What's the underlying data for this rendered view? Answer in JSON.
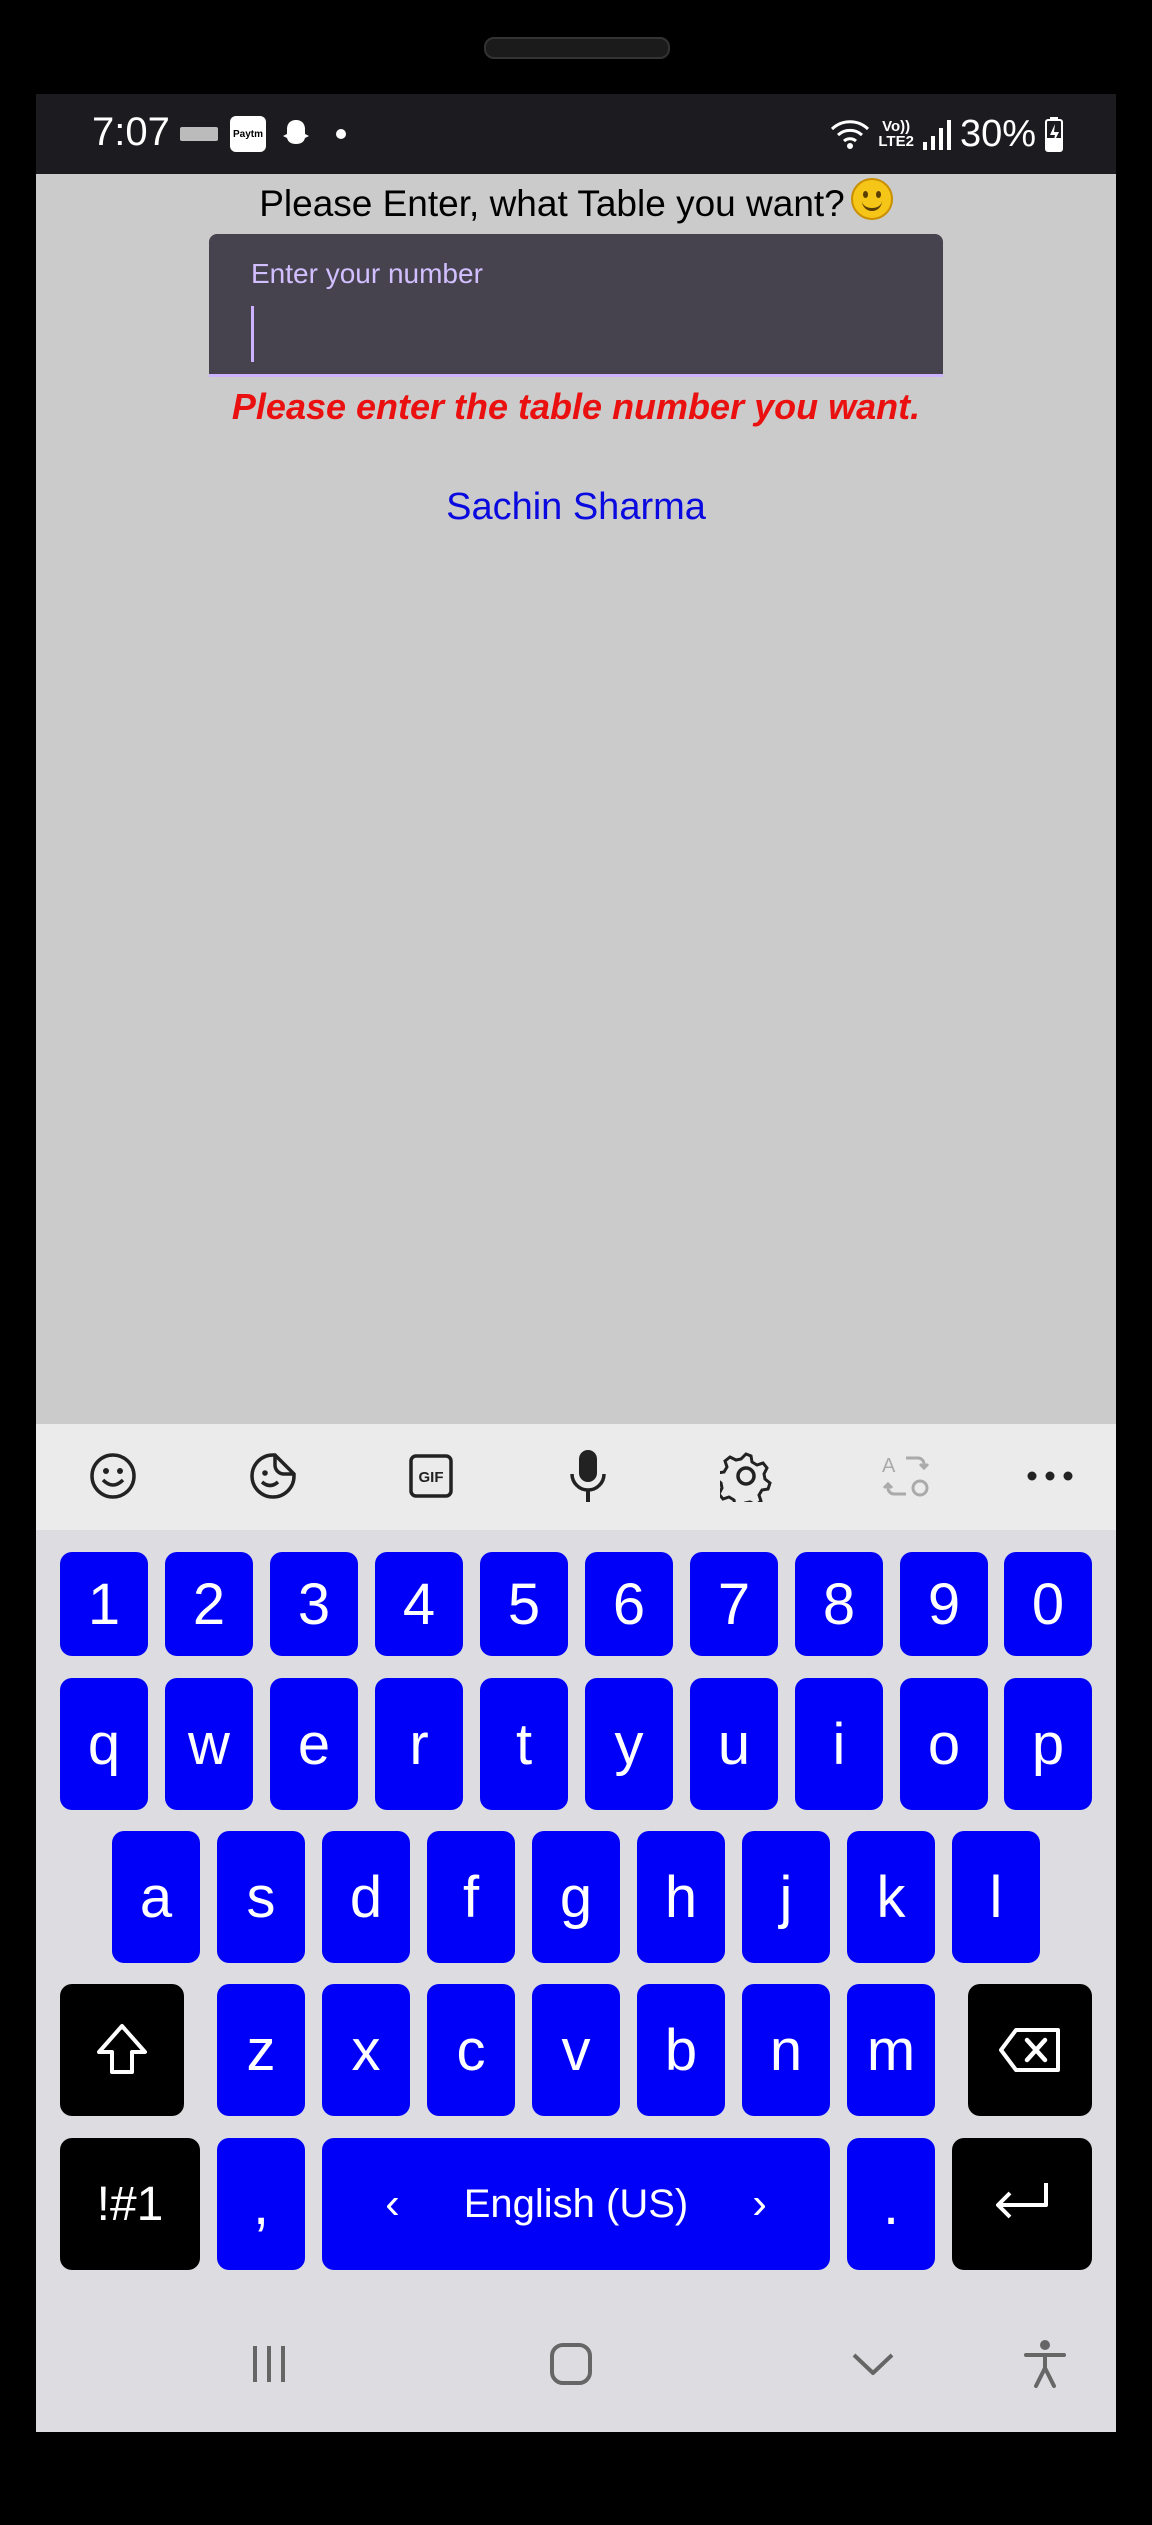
{
  "status_bar": {
    "time": "7:07",
    "notification_icons": [
      "mini-logo-icon",
      "paytm-icon",
      "snapchat-icon",
      "dot-icon"
    ],
    "paytm_text": "Paytm",
    "volte_line1": "Vo))",
    "volte_line2": "LTE2",
    "battery": "30%"
  },
  "content": {
    "title": "Please Enter, what Table you want?",
    "input_label": "Enter your number",
    "input_value": "",
    "error_message": "Please enter the table number you want.",
    "author": "Sachin Sharma"
  },
  "keyboard": {
    "toolbar_icons": [
      "emoji-icon",
      "sticker-icon",
      "gif-icon",
      "mic-icon",
      "settings-icon",
      "translate-icon",
      "more-icon"
    ],
    "gif_text": "GIF",
    "row_numbers": [
      "1",
      "2",
      "3",
      "4",
      "5",
      "6",
      "7",
      "8",
      "9",
      "0"
    ],
    "row_top": [
      "q",
      "w",
      "e",
      "r",
      "t",
      "y",
      "u",
      "i",
      "o",
      "p"
    ],
    "row_home": [
      "a",
      "s",
      "d",
      "f",
      "g",
      "h",
      "j",
      "k",
      "l"
    ],
    "row_bottom": [
      "z",
      "x",
      "c",
      "v",
      "b",
      "n",
      "m"
    ],
    "symbols_label": "!#1",
    "comma": ",",
    "space_label": "English (US)",
    "space_left": "‹",
    "space_right": "›",
    "period": ".",
    "accent_color": "#0000f8"
  },
  "nav_bar": {
    "icons": [
      "recents-icon",
      "home-icon",
      "hide-keyboard-icon",
      "accessibility-icon"
    ]
  }
}
